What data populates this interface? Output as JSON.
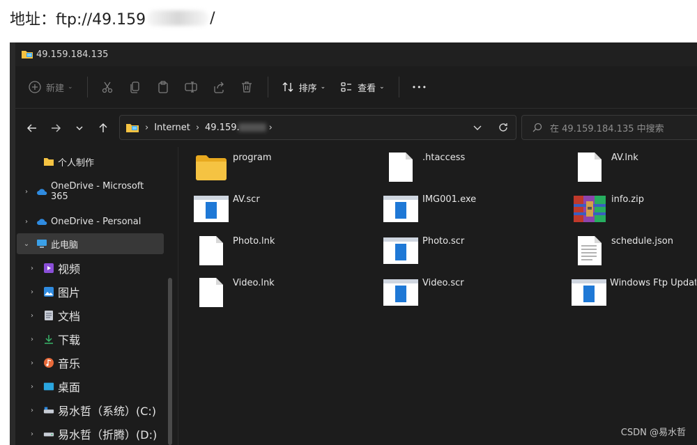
{
  "caption": {
    "prefix": "地址：ftp://49.159",
    "suffix": "/"
  },
  "window": {
    "title": "49.159.184.135"
  },
  "toolbar": {
    "new_label": "新建",
    "sort_label": "排序",
    "view_label": "查看",
    "more_label": "•••"
  },
  "address": {
    "segment1": "Internet",
    "segment2": "49.159."
  },
  "search": {
    "placeholder": "在 49.159.184.135 中搜索"
  },
  "sidebar": {
    "items": [
      {
        "label": "个人制作",
        "icon": "folder-icon"
      },
      {
        "label": "OneDrive - Microsoft 365",
        "icon": "cloud-icon"
      },
      {
        "label": "OneDrive - Personal",
        "icon": "cloud-icon"
      },
      {
        "label": "此电脑",
        "icon": "computer-icon"
      },
      {
        "label": "视频",
        "icon": "video-icon"
      },
      {
        "label": "图片",
        "icon": "pictures-icon"
      },
      {
        "label": "文档",
        "icon": "document-icon"
      },
      {
        "label": "下载",
        "icon": "download-icon"
      },
      {
        "label": "音乐",
        "icon": "music-icon"
      },
      {
        "label": "桌面",
        "icon": "desktop-icon"
      },
      {
        "label": "易水哲（系统）(C:)",
        "icon": "drive-icon"
      },
      {
        "label": "易水哲（折腾）(D:)",
        "icon": "drive-icon"
      }
    ]
  },
  "files": [
    {
      "name": "program",
      "type": "folder"
    },
    {
      "name": ".htaccess",
      "type": "blank"
    },
    {
      "name": "AV.lnk",
      "type": "blank"
    },
    {
      "name": "AV.scr",
      "type": "app"
    },
    {
      "name": "IMG001.exe",
      "type": "app"
    },
    {
      "name": "info.zip",
      "type": "zip"
    },
    {
      "name": "Photo.lnk",
      "type": "blank"
    },
    {
      "name": "Photo.scr",
      "type": "app"
    },
    {
      "name": "schedule.json",
      "type": "text"
    },
    {
      "name": "Video.lnk",
      "type": "blank"
    },
    {
      "name": "Video.scr",
      "type": "app"
    },
    {
      "name": "Windows Ftp Update",
      "type": "app"
    }
  ],
  "watermark": "CSDN @易水哲",
  "colors": {
    "background": "#1c1c1c",
    "folder": "#f5c342",
    "app_blue": "#1e78d6",
    "onedrive": "#2f8be0"
  }
}
